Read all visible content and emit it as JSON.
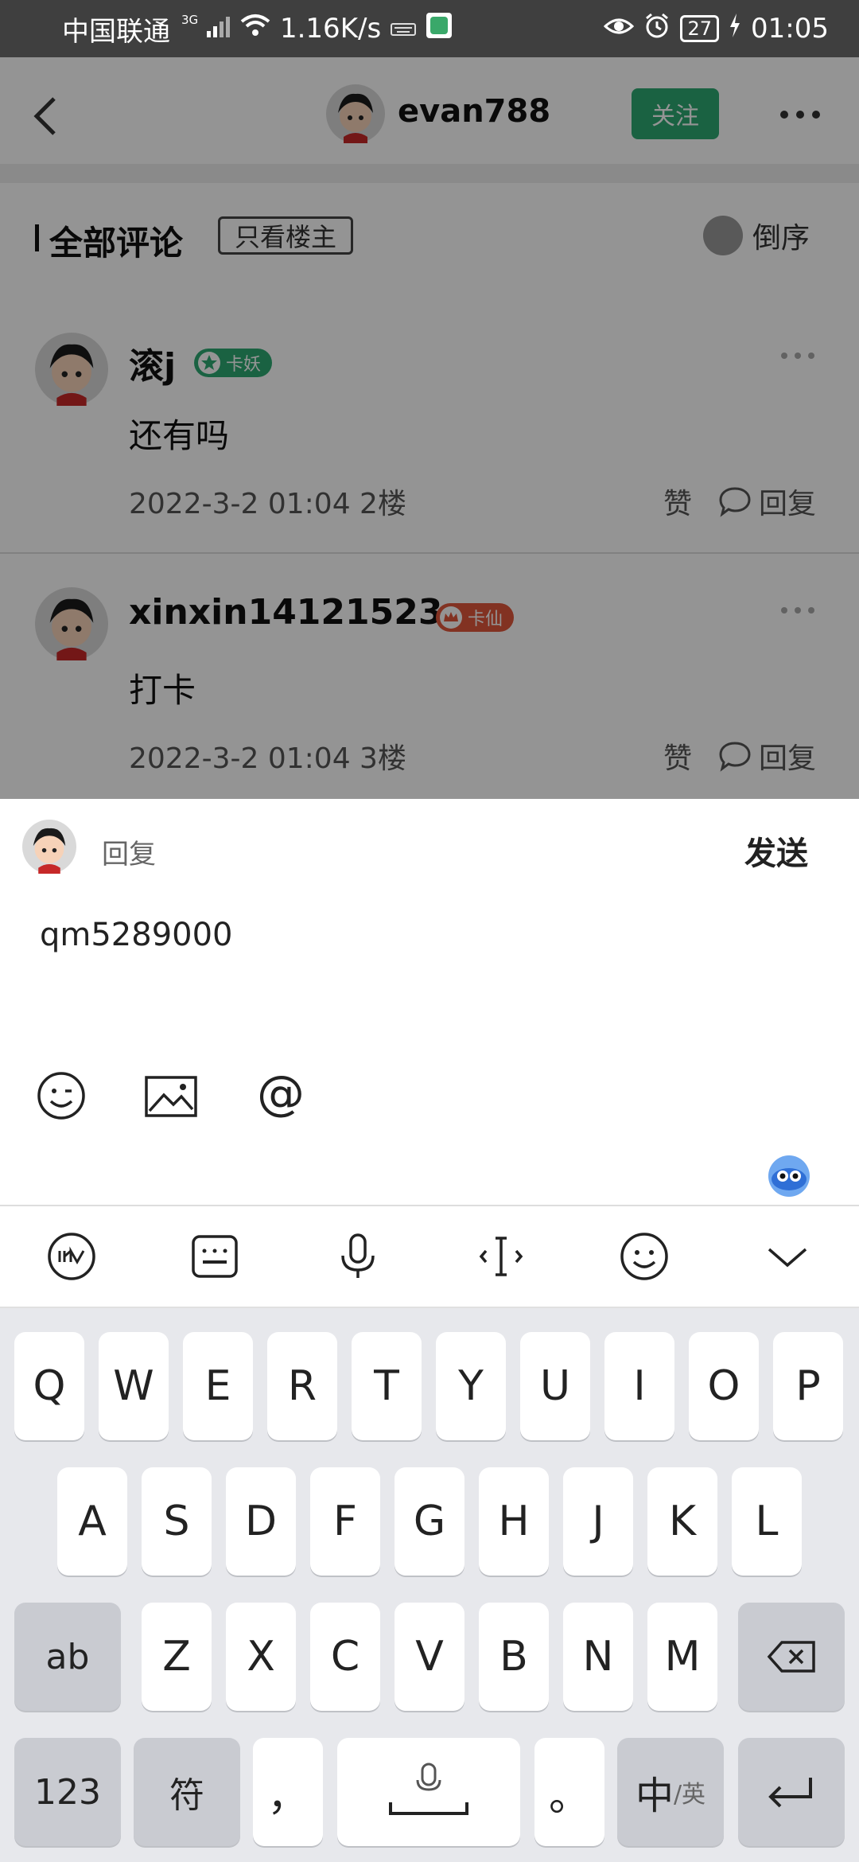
{
  "status_bar": {
    "carrier": "中国联通",
    "network_sup": "3G",
    "speed": "1.16K/s",
    "battery": "27",
    "time": "01:05"
  },
  "header": {
    "username": "evan788",
    "follow_label": "关注"
  },
  "filter": {
    "title": "全部评论",
    "option": "只看楼主",
    "sort_label": "倒序"
  },
  "comments": [
    {
      "name": "滚j",
      "badge": "卡妖",
      "text": "还有吗",
      "meta": "2022-3-2 01:04  2楼",
      "like": "赞",
      "reply": "回复"
    },
    {
      "name": "xinxin14121523",
      "badge": "卡仙",
      "text": "打卡",
      "meta": "2022-3-2 01:04  3楼",
      "like": "赞",
      "reply": "回复"
    }
  ],
  "reply_panel": {
    "label": "回复",
    "send": "发送",
    "input_value": "qm5289000"
  },
  "keyboard": {
    "row1": [
      "Q",
      "W",
      "E",
      "R",
      "T",
      "Y",
      "U",
      "I",
      "O",
      "P"
    ],
    "row2": [
      "A",
      "S",
      "D",
      "F",
      "G",
      "H",
      "J",
      "K",
      "L"
    ],
    "row3": [
      "Z",
      "X",
      "C",
      "V",
      "B",
      "N",
      "M"
    ],
    "shift_label": "ab",
    "num_label": "123",
    "symbol_label": "符",
    "comma": "，",
    "period": "。",
    "lang_main": "中",
    "lang_alt": "/英"
  },
  "colors": {
    "accent_green": "#2eaa73",
    "badge_green": "#2eaa73",
    "badge_red": "#e0573c"
  }
}
